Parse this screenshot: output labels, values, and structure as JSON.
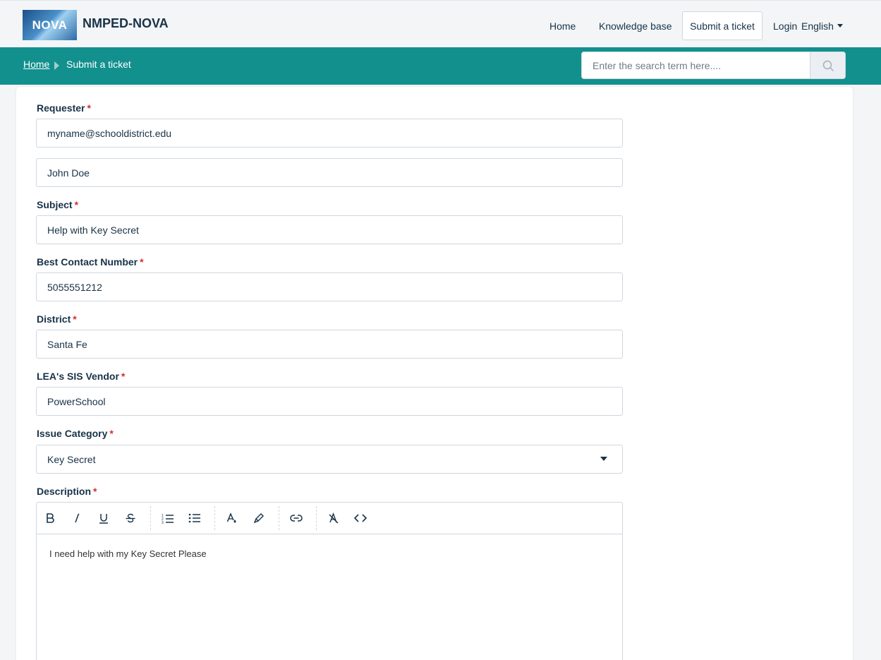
{
  "header": {
    "logo_text": "NOVA",
    "brand": "NMPED-NOVA",
    "nav": {
      "home": "Home",
      "knowledge_base": "Knowledge base",
      "submit_ticket": "Submit a ticket",
      "login": "Login",
      "language": "English"
    }
  },
  "breadcrumb": {
    "home": "Home",
    "current": "Submit a ticket"
  },
  "search": {
    "placeholder": "Enter the search term here...."
  },
  "form": {
    "requester": {
      "label": "Requester",
      "email": "myname@schooldistrict.edu",
      "name": "John Doe"
    },
    "subject": {
      "label": "Subject",
      "value": "Help with Key Secret"
    },
    "contact": {
      "label": "Best Contact Number",
      "value": "5055551212"
    },
    "district": {
      "label": "District",
      "value": "Santa Fe"
    },
    "sis_vendor": {
      "label": "LEA's SIS Vendor",
      "value": "PowerSchool"
    },
    "issue_category": {
      "label": "Issue Category",
      "value": "Key Secret"
    },
    "description": {
      "label": "Description",
      "value": "I need help with my Key Secret Please"
    },
    "required_mark": "*"
  },
  "toolbar_icons": [
    "bold-icon",
    "italic-icon",
    "underline-icon",
    "strikethrough-icon",
    "ordered-list-icon",
    "unordered-list-icon",
    "text-color-icon",
    "highlight-icon",
    "link-icon",
    "clear-format-icon",
    "code-view-icon"
  ],
  "colors": {
    "teal": "#12908e",
    "text": "#183247",
    "required": "#d72d30",
    "background": "#f3f5f7"
  }
}
